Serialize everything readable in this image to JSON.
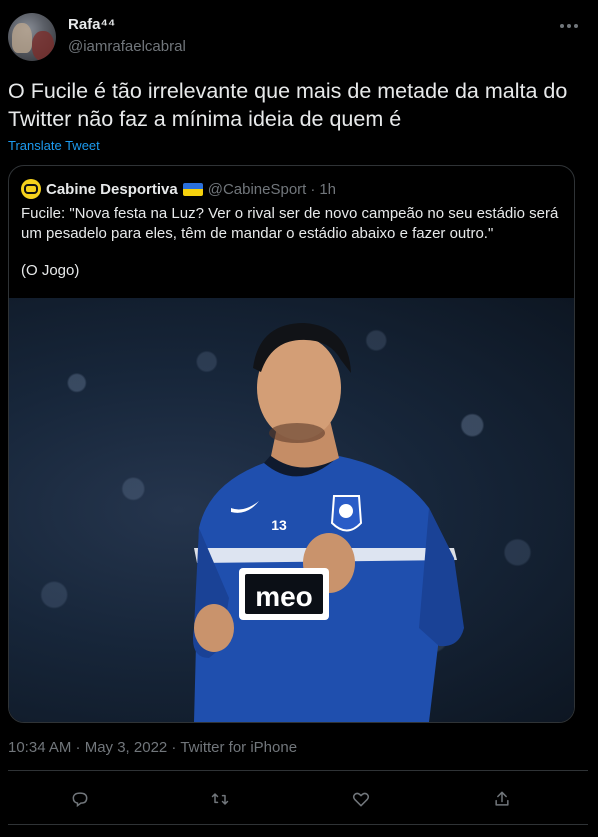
{
  "author": {
    "name": "Rafa⁴⁴",
    "handle": "@iamrafaelcabral"
  },
  "tweet": {
    "text": "O Fucile é tão irrelevante que mais de metade da malta do Twitter não faz a mínima ideia de quem é",
    "translate_label": "Translate Tweet"
  },
  "quote": {
    "name": "Cabine Desportiva",
    "handle": "@CabineSport",
    "separator": "·",
    "time": "1h",
    "text": "Fucile: \"Nova festa na Luz? Ver o rival ser de novo campeão no seu estádio será um pesadelo para eles, têm de mandar o estádio abaixo e fazer outro.\"",
    "source": "(O Jogo)",
    "image": {
      "shirt_text": "meo",
      "shirt_number": "13"
    }
  },
  "meta": {
    "text": "10:34 AM · May 3, 2022 · Twitter for iPhone"
  },
  "actions": [
    "reply-icon",
    "retweet-icon",
    "like-icon",
    "share-icon"
  ],
  "colors": {
    "background": "#000000",
    "text": "#e7e9ea",
    "muted": "#71767b",
    "link": "#1d9bf0",
    "border": "#2f3336",
    "shirt": "#1f4fae"
  }
}
